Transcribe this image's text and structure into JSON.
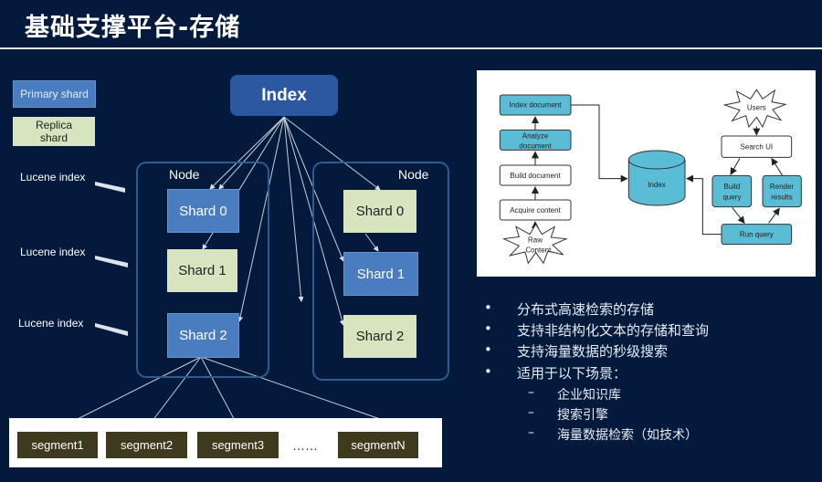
{
  "title": "基础支撑平台-存储",
  "legend": {
    "primary": "Primary shard",
    "replica": "Replica shard"
  },
  "index_label": "Index",
  "lucene_label": "Lucene index",
  "nodes": [
    {
      "label": "Node",
      "shards": [
        "Shard 0",
        "Shard 1",
        "Shard 2"
      ],
      "types": [
        "primary",
        "replica",
        "primary"
      ]
    },
    {
      "label": "Node",
      "shards": [
        "Shard 0",
        "Shard 1",
        "Shard 2"
      ],
      "types": [
        "replica",
        "primary",
        "replica"
      ]
    }
  ],
  "segments": [
    "segment1",
    "segment2",
    "segment3",
    "……",
    "segmentN"
  ],
  "flow": {
    "index_document": "Index document",
    "analyze_document": [
      "Analyze",
      "document"
    ],
    "build_document": "Build document",
    "acquire_content": "Acquire content",
    "raw_content": [
      "Raw",
      "Content"
    ],
    "index": "Index",
    "users": "Users",
    "search_ui": "Search UI",
    "build_query": [
      "Build",
      "query"
    ],
    "render_results": [
      "Render",
      "results"
    ],
    "run_query": "Run query"
  },
  "bullets": [
    "分布式高速检索的存储",
    "支持非结构化文本的存储和查询",
    "支持海量数据的秒级搜索",
    "适用于以下场景："
  ],
  "sub_bullets": [
    "企业知识库",
    "搜索引擎",
    "海量数据检索（如技术）"
  ],
  "colors": {
    "background": "#031a3c",
    "primary": "#4a7cc0",
    "replica": "#d6e4bf",
    "index": "#2b58a0",
    "flow_accent": "#5bbcd6",
    "segment": "#3d3a1e"
  }
}
